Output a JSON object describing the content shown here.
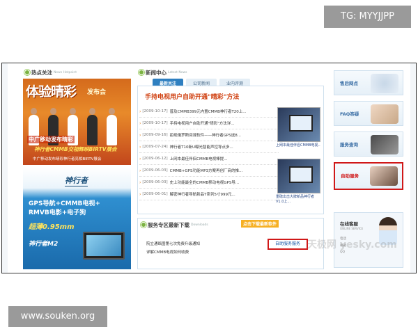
{
  "watermarks": {
    "top_right": "TG: MYYJJPP",
    "bottom_left": "www.souken.org"
  },
  "hot_topics": {
    "title": "热点关注",
    "subtitle": "News Hotpoint",
    "image_big_text": "体验晴彩",
    "image_small_text": "发布会",
    "image_cap1": "中广移动发布晴彩",
    "image_cap2": "神行者CMMB交相辉映BIRTV展会",
    "image_cap3": "中广移动发布晴彩神行者亮相BIRTV展会"
  },
  "promo": {
    "logo": "神行者",
    "line1": "GPS导航+CMMB电视+",
    "line2": "RMVB电影+电子狗",
    "line3": "超薄0.95mm",
    "line4": "神行者M2"
  },
  "news_center": {
    "title": "新闻中心",
    "subtitle": "Latest News",
    "tabs": [
      "最新关注",
      "公司新闻",
      "业内评测"
    ],
    "headline": "手持电视用户自助开通\"晴彩\"方法",
    "items": [
      {
        "date": "[2009-10-17]",
        "text": "普及CMMB399元内置CMMB神行者T20上..."
      },
      {
        "date": "[2009-10-17]",
        "text": "手持电视用户自助开通\"晴彩\"方法详..."
      },
      {
        "date": "[2009-09-16]",
        "text": "拒绝俄罗斯间谍软件——神行者GPS送8..."
      },
      {
        "date": "[2009-07-24]",
        "text": "神行者T10新U曝光智能声控导点多..."
      },
      {
        "date": "[2009-06-12]",
        "text": "上网本最佳伴侣CMMB电视棒提..."
      },
      {
        "date": "[2009-06-03]",
        "text": "CMMB+GPS功能MP3方案再创厂商的推..."
      },
      {
        "date": "[2009-06-03]",
        "text": "史上功能最全的CMMB移动电视GPS导..."
      },
      {
        "date": "[2009-06-01]",
        "text": "解密神行者导航新品T系列5寸999元..."
      }
    ],
    "thumb1_caption": "上网本最佳伴侣CMMB电视..",
    "thumb2_caption": "重磅出击大牌新品神行者V1.0上..."
  },
  "service": {
    "title": "服务专区最新下载",
    "subtitle": "Downloads",
    "download_button": "点击下载最新软件",
    "items": [
      "院立通络图第七次免费升级通知",
      "详解CMMB电视如何收费"
    ],
    "self_service": "自助服务服务"
  },
  "sidebar": {
    "cards": [
      "售后网点",
      "FAQ答疑",
      "服务查询",
      "自助服务"
    ],
    "online": {
      "title": "在线客服",
      "subtitle": "ONLINE SERVICE",
      "phone_label": "电话",
      "email_label": "邮箱",
      "qq_label": "QQ"
    }
  },
  "faint_watermark": "天极网 yesky.com",
  "colors": {
    "accent_blue": "#2e7fc0",
    "highlight_red": "#d01818",
    "headline_orange": "#d04010"
  }
}
